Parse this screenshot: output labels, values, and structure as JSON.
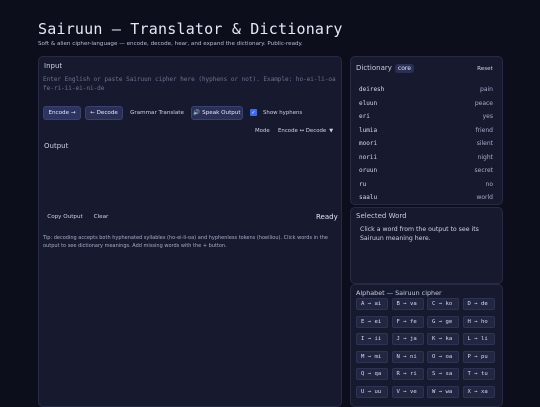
{
  "header": {
    "title": "Sairuun — Translator & Dictionary",
    "subtitle": "Soft & alien cipher-language — encode, decode, hear, and expand the dictionary. Public-ready."
  },
  "input": {
    "label": "Input",
    "placeholder": "Enter English or paste Sairuun cipher here (hyphens or not). Example: ho-ei-li-oa fe-ri-ii-ei-ni-de"
  },
  "buttons": {
    "encode": "Encode →",
    "decode": "← Decode",
    "grammar": "Grammar Translate",
    "speak": "🔊 Speak Output",
    "show_hyphens": "Show hyphens",
    "copy": "Copy Output",
    "clear": "Clear",
    "reset": "Reset"
  },
  "mode": {
    "label": "Mode",
    "value": "Encode ↔ Decode"
  },
  "output": {
    "label": "Output",
    "status": "Ready",
    "tip": "Tip: decoding accepts both hyphenated syllables (ho-ei-li-oa) and hyphenless tokens (hoeiliou). Click words in the output to see dictionary meanings. Add missing words with the + button."
  },
  "dictionary": {
    "title": "Dictionary",
    "badge": "core",
    "entries": [
      {
        "word": "deiresh",
        "meaning": "pain"
      },
      {
        "word": "eluun",
        "meaning": "peace"
      },
      {
        "word": "eri",
        "meaning": "yes"
      },
      {
        "word": "lumia",
        "meaning": "friend"
      },
      {
        "word": "moori",
        "meaning": "silent"
      },
      {
        "word": "norii",
        "meaning": "night"
      },
      {
        "word": "oruun",
        "meaning": "secret"
      },
      {
        "word": "ru",
        "meaning": "no"
      },
      {
        "word": "saalu",
        "meaning": "world"
      }
    ]
  },
  "selected_word": {
    "title": "Selected Word",
    "text": "Click a word from the output to see its Sairuun meaning here."
  },
  "alphabet": {
    "title": "Alphabet — Sairuun cipher",
    "items": [
      "A → ai",
      "B → va",
      "C → ko",
      "D → de",
      "E → ei",
      "F → fe",
      "G → ge",
      "H → ho",
      "I → ii",
      "J → ja",
      "K → ka",
      "L → li",
      "M → mi",
      "N → ni",
      "O → oa",
      "P → pu",
      "Q → qa",
      "R → ri",
      "S → sa",
      "T → tu",
      "U → uu",
      "V → ve",
      "W → wa",
      "X → xa"
    ]
  },
  "colors": {
    "accent": "#3b6cf0",
    "bg": "#0d0e1c",
    "panel": "#171a2e"
  }
}
